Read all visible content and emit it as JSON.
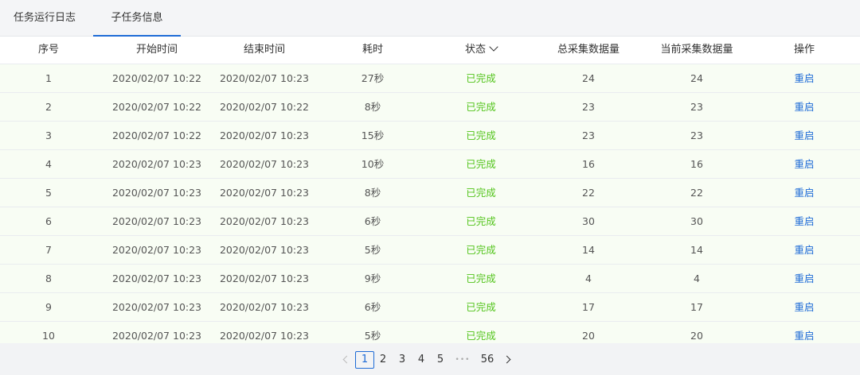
{
  "tabs": [
    {
      "label": "任务运行日志",
      "active": false
    },
    {
      "label": "子任务信息",
      "active": true
    }
  ],
  "table": {
    "headers": [
      "序号",
      "开始时间",
      "结束时间",
      "耗时",
      "状态",
      "总采集数据量",
      "当前采集数据量",
      "操作"
    ],
    "rows": [
      [
        "1",
        "2020/02/07 10:22",
        "2020/02/07 10:23",
        "27秒",
        "已完成",
        "24",
        "24",
        "重启"
      ],
      [
        "2",
        "2020/02/07 10:22",
        "2020/02/07 10:22",
        "8秒",
        "已完成",
        "23",
        "23",
        "重启"
      ],
      [
        "3",
        "2020/02/07 10:22",
        "2020/02/07 10:23",
        "15秒",
        "已完成",
        "23",
        "23",
        "重启"
      ],
      [
        "4",
        "2020/02/07 10:23",
        "2020/02/07 10:23",
        "10秒",
        "已完成",
        "16",
        "16",
        "重启"
      ],
      [
        "5",
        "2020/02/07 10:23",
        "2020/02/07 10:23",
        "8秒",
        "已完成",
        "22",
        "22",
        "重启"
      ],
      [
        "6",
        "2020/02/07 10:23",
        "2020/02/07 10:23",
        "6秒",
        "已完成",
        "30",
        "30",
        "重启"
      ],
      [
        "7",
        "2020/02/07 10:23",
        "2020/02/07 10:23",
        "5秒",
        "已完成",
        "14",
        "14",
        "重启"
      ],
      [
        "8",
        "2020/02/07 10:23",
        "2020/02/07 10:23",
        "9秒",
        "已完成",
        "4",
        "4",
        "重启"
      ],
      [
        "9",
        "2020/02/07 10:23",
        "2020/02/07 10:23",
        "6秒",
        "已完成",
        "17",
        "17",
        "重启"
      ],
      [
        "10",
        "2020/02/07 10:23",
        "2020/02/07 10:23",
        "5秒",
        "已完成",
        "20",
        "20",
        "重启"
      ]
    ]
  },
  "pagination": {
    "pages": [
      "1",
      "2",
      "3",
      "4",
      "5"
    ],
    "ellipsis": "•••",
    "last_page": "56",
    "current": "1"
  },
  "colors": {
    "accent": "#1e6bd6",
    "status_done": "#52c41a",
    "row_bg": "#f8fdf4"
  },
  "icons": {
    "status_filter": "chevron-down-icon",
    "prev": "chevron-left-icon",
    "next": "chevron-right-icon"
  }
}
